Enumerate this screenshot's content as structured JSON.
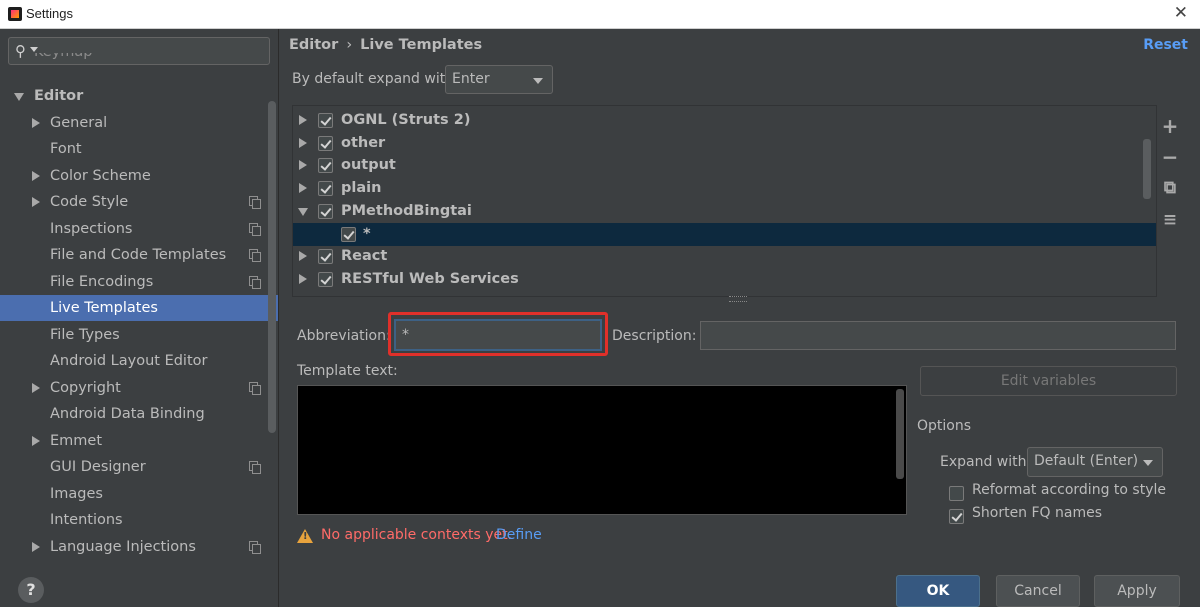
{
  "window": {
    "title": "Settings"
  },
  "sidebar": {
    "partial_item": "Keymap",
    "items": [
      {
        "label": "Editor",
        "level": 0,
        "expanded": true,
        "arrow": "down"
      },
      {
        "label": "General",
        "level": 1,
        "arrow": "right"
      },
      {
        "label": "Font",
        "level": 1
      },
      {
        "label": "Color Scheme",
        "level": 1,
        "arrow": "right"
      },
      {
        "label": "Code Style",
        "level": 1,
        "arrow": "right",
        "copy_icon": true
      },
      {
        "label": "Inspections",
        "level": 1,
        "copy_icon": true
      },
      {
        "label": "File and Code Templates",
        "level": 1,
        "copy_icon": true
      },
      {
        "label": "File Encodings",
        "level": 1,
        "copy_icon": true
      },
      {
        "label": "Live Templates",
        "level": 1,
        "selected": true
      },
      {
        "label": "File Types",
        "level": 1
      },
      {
        "label": "Android Layout Editor",
        "level": 1
      },
      {
        "label": "Copyright",
        "level": 1,
        "arrow": "right",
        "copy_icon": true
      },
      {
        "label": "Android Data Binding",
        "level": 1
      },
      {
        "label": "Emmet",
        "level": 1,
        "arrow": "right"
      },
      {
        "label": "GUI Designer",
        "level": 1,
        "copy_icon": true
      },
      {
        "label": "Images",
        "level": 1
      },
      {
        "label": "Intentions",
        "level": 1
      },
      {
        "label": "Language Injections",
        "level": 1,
        "arrow": "right",
        "copy_icon": true
      }
    ]
  },
  "header": {
    "breadcrumb_parent": "Editor",
    "breadcrumb_sep": "›",
    "breadcrumb_current": "Live Templates",
    "reset_label": "Reset"
  },
  "expand": {
    "label": "By default expand with",
    "value": "Enter"
  },
  "templates": [
    {
      "name": "OGNL (Struts 2)",
      "checked": true,
      "arrow": "right"
    },
    {
      "name": "other",
      "checked": true,
      "arrow": "right"
    },
    {
      "name": "output",
      "checked": true,
      "arrow": "right"
    },
    {
      "name": "plain",
      "checked": true,
      "arrow": "right"
    },
    {
      "name": "PMethodBingtai",
      "checked": true,
      "arrow": "down"
    },
    {
      "name": "*",
      "checked": true,
      "child": true,
      "selected": true
    },
    {
      "name": "React",
      "checked": true,
      "arrow": "right"
    },
    {
      "name": "RESTful Web Services",
      "checked": true,
      "arrow": "right"
    }
  ],
  "tools": {
    "add": "+",
    "remove": "−",
    "copy": "⧉",
    "edit": "≡"
  },
  "form": {
    "abbreviation_label": "Abbreviation:",
    "abbreviation_value": "*",
    "description_label": "Description:",
    "description_value": "",
    "template_text_label": "Template text:",
    "edit_variables_label": "Edit variables"
  },
  "options": {
    "title": "Options",
    "expand_with_label": "Expand with",
    "expand_with_value": "Default (Enter)",
    "reformat_label": "Reformat according to style",
    "reformat_checked": false,
    "shorten_label": "Shorten FQ names",
    "shorten_checked": true
  },
  "warning": {
    "text": "No applicable contexts yet.",
    "link": "Define"
  },
  "footer": {
    "help": "?",
    "ok_label": "OK",
    "cancel_label": "Cancel",
    "apply_label": "Apply"
  },
  "colors": {
    "background": "#3c3f41",
    "selection": "#4b6eaf",
    "accent_link": "#589df6",
    "warning_text": "#ff6b68",
    "highlight_box": "#e0302a"
  }
}
